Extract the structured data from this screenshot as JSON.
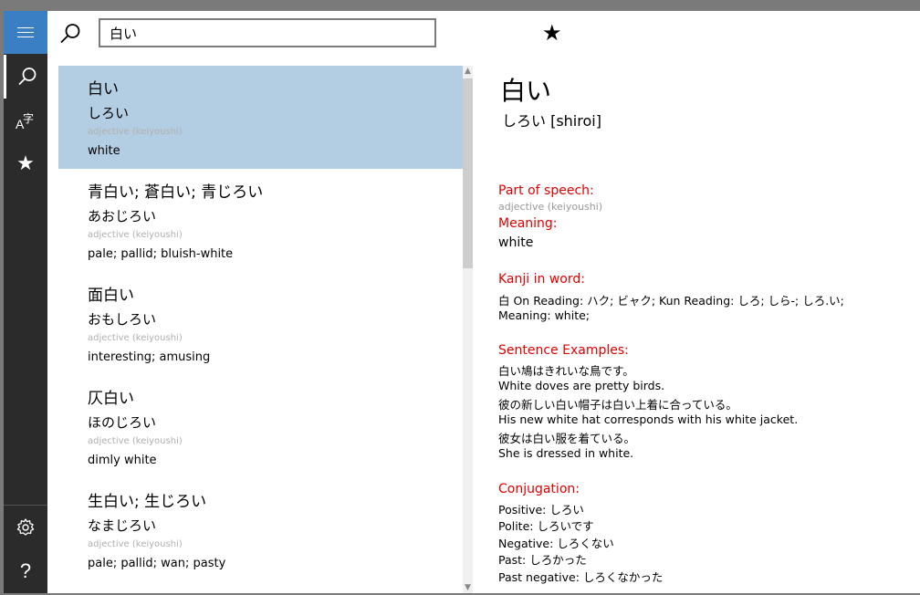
{
  "search": {
    "value": "白い",
    "favorite_icon": "star-icon"
  },
  "nav": {
    "menu_icon": "hamburger-icon",
    "items": [
      {
        "icon": "search-icon",
        "active": true
      },
      {
        "icon": "kanji-icon",
        "label": "A字"
      },
      {
        "icon": "star-icon"
      }
    ],
    "bottom": [
      {
        "icon": "gear-icon"
      },
      {
        "icon": "help-icon",
        "label": "?"
      }
    ],
    "accent_color": "#3a7fc4"
  },
  "results": [
    {
      "kanji": "白い",
      "kana": "しろい",
      "pos": "adjective (keiyoushi)",
      "meaning": "white",
      "selected": true
    },
    {
      "kanji": "青白い; 蒼白い; 青じろい",
      "kana": "あおじろい",
      "pos": "adjective (keiyoushi)",
      "meaning": "pale; pallid; bluish-white"
    },
    {
      "kanji": "面白い",
      "kana": "おもしろい",
      "pos": "adjective (keiyoushi)",
      "meaning": "interesting; amusing"
    },
    {
      "kanji": "仄白い",
      "kana": "ほのじろい",
      "pos": "adjective (keiyoushi)",
      "meaning": "dimly white"
    },
    {
      "kanji": "生白い; 生じろい",
      "kana": "なまじろい",
      "pos": "adjective (keiyoushi)",
      "meaning": "pale; pallid; wan; pasty"
    }
  ],
  "detail": {
    "title": "白い",
    "reading": "しろい [shiroi]",
    "pos_label": "Part of speech:",
    "pos_value": "adjective (keiyoushi)",
    "meaning_label": "Meaning:",
    "meaning_value": "white",
    "kanji_label": "Kanji in word:",
    "kanji_line": " 白 On Reading: ハク; ビャク;  Kun Reading: しろ; しら-; しろ.い;",
    "kanji_meaning": "Meaning: white;",
    "examples_label": "Sentence Examples:",
    "examples": [
      "白い鳩はきれいな鳥です。",
      "White doves are pretty birds.",
      "彼の新しい白い帽子は白い上着に合っている。",
      "His new white hat corresponds with his white jacket.",
      "彼女は白い服を着ている。",
      "She is dressed in white."
    ],
    "conjugation_label": "Conjugation:",
    "conjugation": [
      "Positive: しろい",
      "Polite: しろいです",
      "Negative: しろくない",
      "Past: しろかった",
      "Past negative: しろくなかった"
    ],
    "label_color": "#e00000"
  }
}
